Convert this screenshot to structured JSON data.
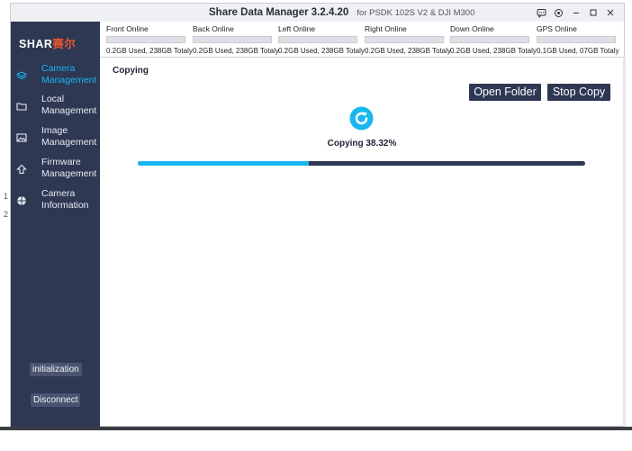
{
  "window": {
    "title": "Share Data Manager 3.2.4.20",
    "subtitle": "for PSDK 102S V2 & DJI M300"
  },
  "logo": {
    "text_main": "SHAR",
    "text_accent": "赛尔"
  },
  "sidebar": {
    "items": [
      {
        "label_line1": "Camera",
        "label_line2": "Management",
        "icon": "layers-icon",
        "active": true
      },
      {
        "label_line1": "Local",
        "label_line2": "Management",
        "icon": "folder-icon",
        "active": false
      },
      {
        "label_line1": "Image",
        "label_line2": "Management",
        "icon": "image-icon",
        "active": false
      },
      {
        "label_line1": "Firmware",
        "label_line2": "Management",
        "icon": "upload-arrow-icon",
        "active": false
      },
      {
        "label_line1": "Camera",
        "label_line2": "Information",
        "icon": "globe-icon",
        "active": false
      }
    ],
    "initialization_label": "initialization",
    "disconnect_label": "Disconnect"
  },
  "cameras": [
    {
      "name": "Front Online",
      "usage": "0.2GB Used, 238GB Totaly"
    },
    {
      "name": "Back Online",
      "usage": "0.2GB Used, 238GB Totaly"
    },
    {
      "name": "Left Online",
      "usage": "0.2GB Used, 238GB Totaly"
    },
    {
      "name": "Right Online",
      "usage": "0.2GB Used, 238GB Totaly"
    },
    {
      "name": "Down Online",
      "usage": "0.2GB Used, 238GB Totaly"
    },
    {
      "name": "GPS Online",
      "usage": "0.1GB Used, 07GB Totaly"
    }
  ],
  "main": {
    "section_title": "Copying",
    "open_folder_label": "Open Folder",
    "stop_copy_label": "Stop Copy",
    "status_text": "Copying 38.32%",
    "progress_percent": 38.32
  },
  "colors": {
    "sidebar_bg": "#2e3853",
    "accent": "#18b7ef",
    "logo_accent": "#e8552f"
  }
}
